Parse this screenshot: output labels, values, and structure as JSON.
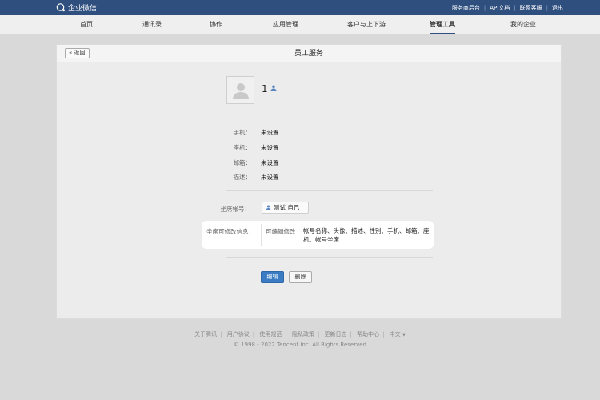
{
  "header": {
    "brand": "企业微信",
    "links": [
      "服务商后台",
      "API文档",
      "联系客服",
      "退出"
    ]
  },
  "nav": {
    "items": [
      "首页",
      "通讯录",
      "协作",
      "应用管理",
      "客户与上下游",
      "管理工具",
      "我的企业"
    ],
    "active": "管理工具"
  },
  "page": {
    "back_label": "返回",
    "title": "员工服务"
  },
  "profile": {
    "name": "1",
    "fields": [
      {
        "label": "手机：",
        "value": "未设置"
      },
      {
        "label": "座机：",
        "value": "未设置"
      },
      {
        "label": "邮箱：",
        "value": "未设置"
      },
      {
        "label": "描述：",
        "value": "未设置"
      }
    ]
  },
  "seat": {
    "label": "坐席帐号：",
    "value": "测试 自己"
  },
  "editable": {
    "label": "坐席可修改信息：",
    "sublabel": "可编辑修改",
    "value": "帐号名称、头像、描述、性别、手机、邮箱、座机、帐号坐席"
  },
  "actions": {
    "edit_label": "编辑",
    "delete_label": "删除"
  },
  "footer": {
    "links": [
      "关于腾讯",
      "用户协议",
      "使用规范",
      "隐私政策",
      "更新日志",
      "帮助中心",
      "中文"
    ],
    "copyright": "© 1998 - 2022 Tencent Inc. All Rights Reserved"
  },
  "colors": {
    "topbar": "#2f4f7f",
    "primary": "#3a7bc4",
    "background": "#d9d9d9"
  }
}
